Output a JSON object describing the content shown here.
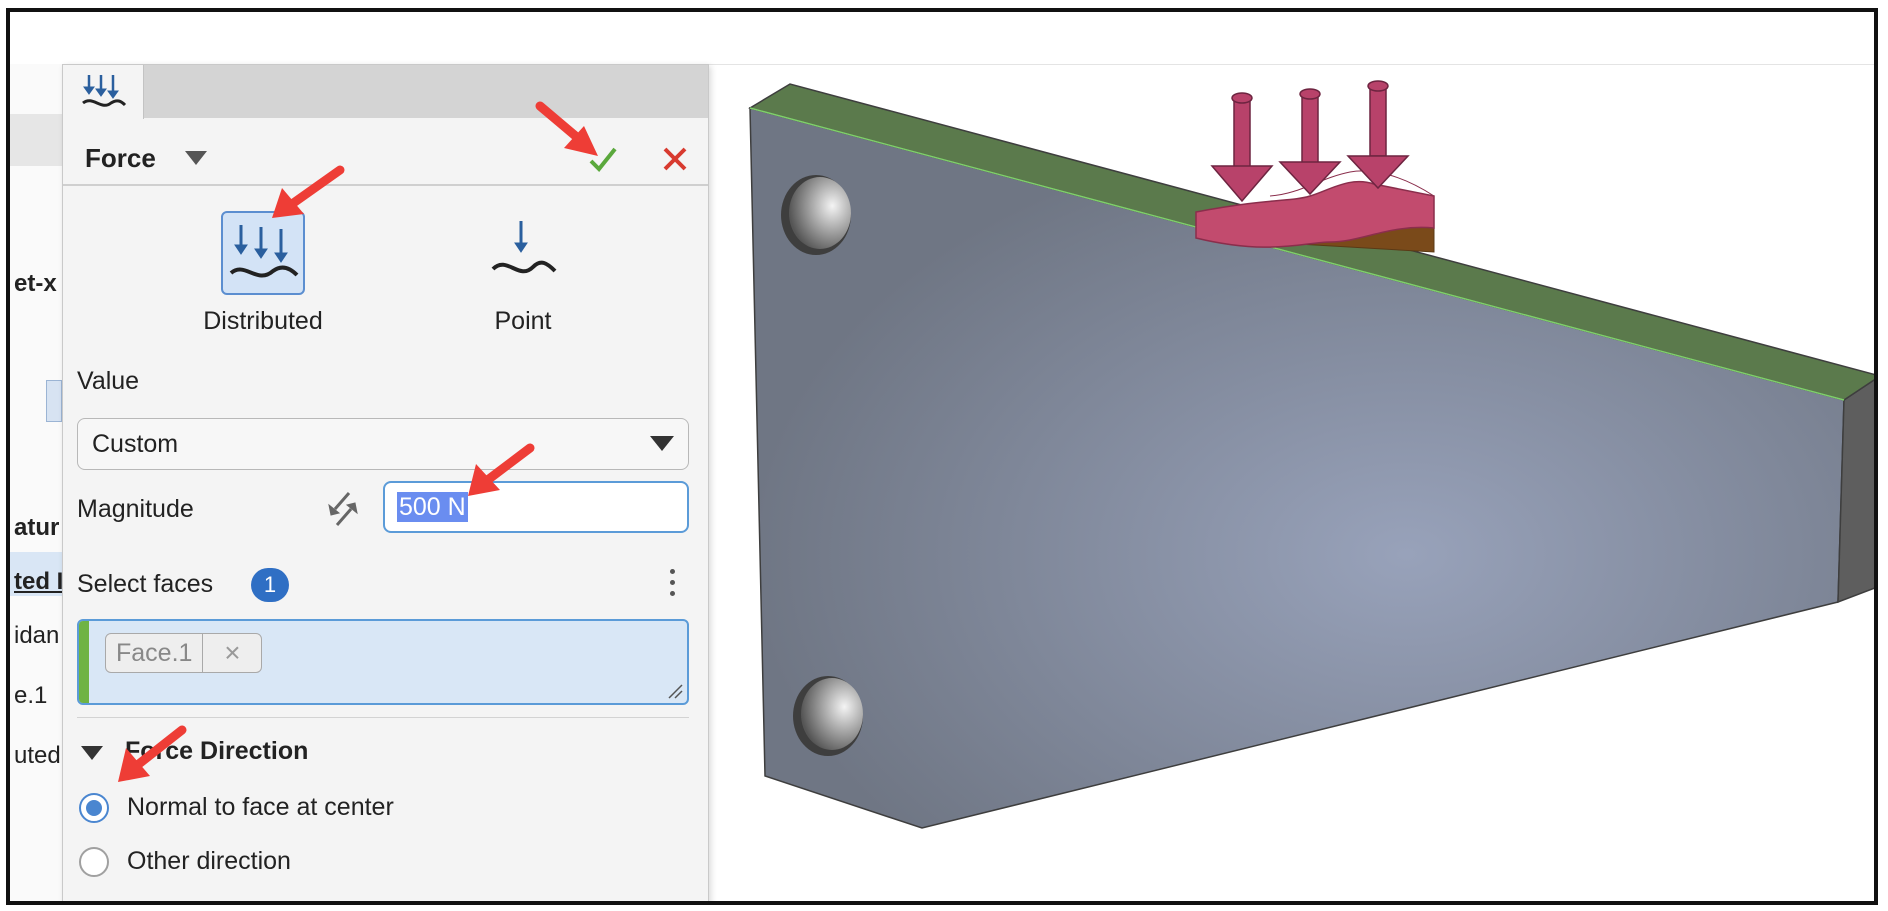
{
  "background_panel": {
    "texts": [
      "et-x",
      "atur",
      "ted I",
      "idan",
      "e.1",
      "uted"
    ],
    "z_glyph": "Z"
  },
  "dialog": {
    "title": "Force",
    "types": [
      {
        "label": "Distributed",
        "selected": true
      },
      {
        "label": "Point",
        "selected": false
      }
    ],
    "value_label": "Value",
    "value_selected": "Custom",
    "magnitude_label": "Magnitude",
    "magnitude_value": "500 N",
    "select_faces_label": "Select faces",
    "select_faces_count": "1",
    "faces": [
      {
        "label": "Face.1"
      }
    ],
    "force_direction_title": "Force Direction",
    "direction_options": [
      {
        "label": "Normal to face at center",
        "selected": true
      },
      {
        "label": "Other direction",
        "selected": false
      }
    ]
  },
  "colors": {
    "accent": "#2f6fc4",
    "confirm": "#5aa83c",
    "cancel": "#d83a2f",
    "annotation_arrow": "#ee3d36",
    "part_body": "#7f8898",
    "part_top": "#5b7a4c",
    "load": "#c24b6e"
  },
  "icons": {
    "tab": "distributed-force-icon",
    "confirm": "checkmark-icon",
    "cancel": "close-icon",
    "swap": "swap-direction-icon"
  }
}
